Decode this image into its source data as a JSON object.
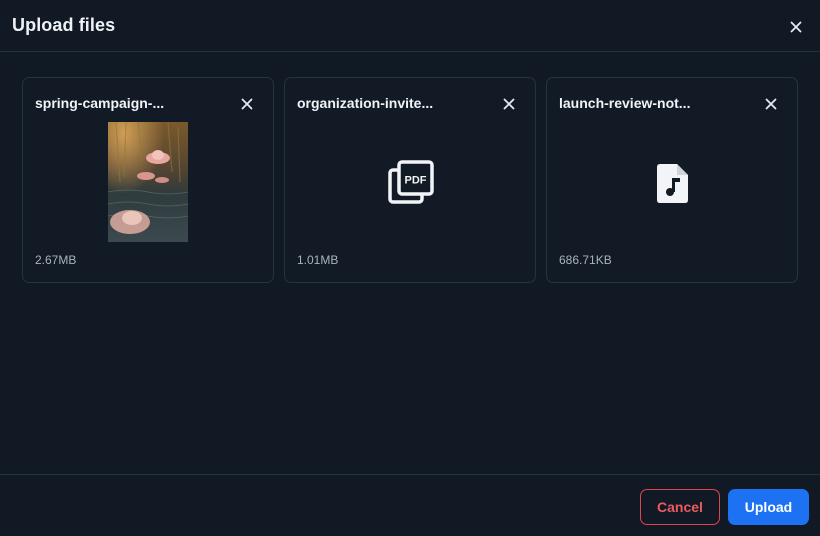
{
  "dialog": {
    "title": "Upload files"
  },
  "files": [
    {
      "name": "spring-campaign-...",
      "size": "2.67MB",
      "type": "image-preview"
    },
    {
      "name": "organization-invite...",
      "size": "1.01MB",
      "type": "pdf-icon"
    },
    {
      "name": "launch-review-not...",
      "size": "686.71KB",
      "type": "audio-file-icon"
    }
  ],
  "footer": {
    "cancel_label": "Cancel",
    "upload_label": "Upload"
  },
  "colors": {
    "background": "#111925",
    "accent": "#1c72f2",
    "danger": "#e0454c"
  }
}
